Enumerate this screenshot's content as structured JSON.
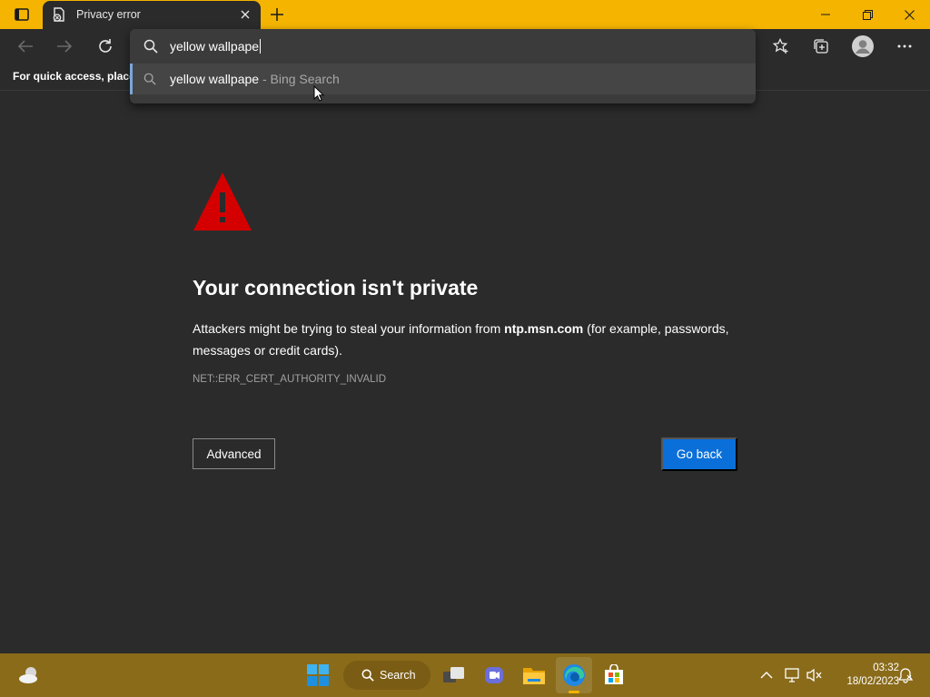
{
  "tab": {
    "title": "Privacy error"
  },
  "omnibox": {
    "input_value": "yellow wallpape",
    "suggestion": {
      "query": "yellow wallpape",
      "suffix": " - Bing Search"
    }
  },
  "favorites_bar": {
    "text": "For quick access, place y"
  },
  "error": {
    "title": "Your connection isn't private",
    "desc_before": "Attackers might be trying to steal your information from ",
    "host": "ntp.msn.com",
    "desc_after": " (for example, passwords, messages or credit cards).",
    "code": "NET::ERR_CERT_AUTHORITY_INVALID",
    "advanced_label": "Advanced",
    "go_back_label": "Go back"
  },
  "taskbar": {
    "search_label": "Search",
    "time": "03:32",
    "date": "18/02/2023"
  },
  "colors": {
    "titlebar": "#f4b400",
    "page_bg": "#2b2b2b",
    "primary_button": "#0a6fd8",
    "warning": "#d40000",
    "taskbar": "#8a6b1a"
  },
  "icons": [
    "tab-actions-icon",
    "privacy-error-favicon",
    "close-icon",
    "plus-icon",
    "minimize-icon",
    "restore-icon",
    "window-close-icon",
    "back-arrow-icon",
    "forward-arrow-icon",
    "refresh-icon",
    "search-icon",
    "favorites-star-icon",
    "collections-icon",
    "profile-avatar-icon",
    "more-dots-icon",
    "warning-triangle-icon",
    "mouse-cursor-icon",
    "weather-icon",
    "windows-start-icon",
    "task-view-icon",
    "teams-chat-icon",
    "file-explorer-icon",
    "edge-icon",
    "store-icon",
    "chevron-up-icon",
    "network-icon",
    "volume-muted-icon",
    "notification-icon"
  ]
}
